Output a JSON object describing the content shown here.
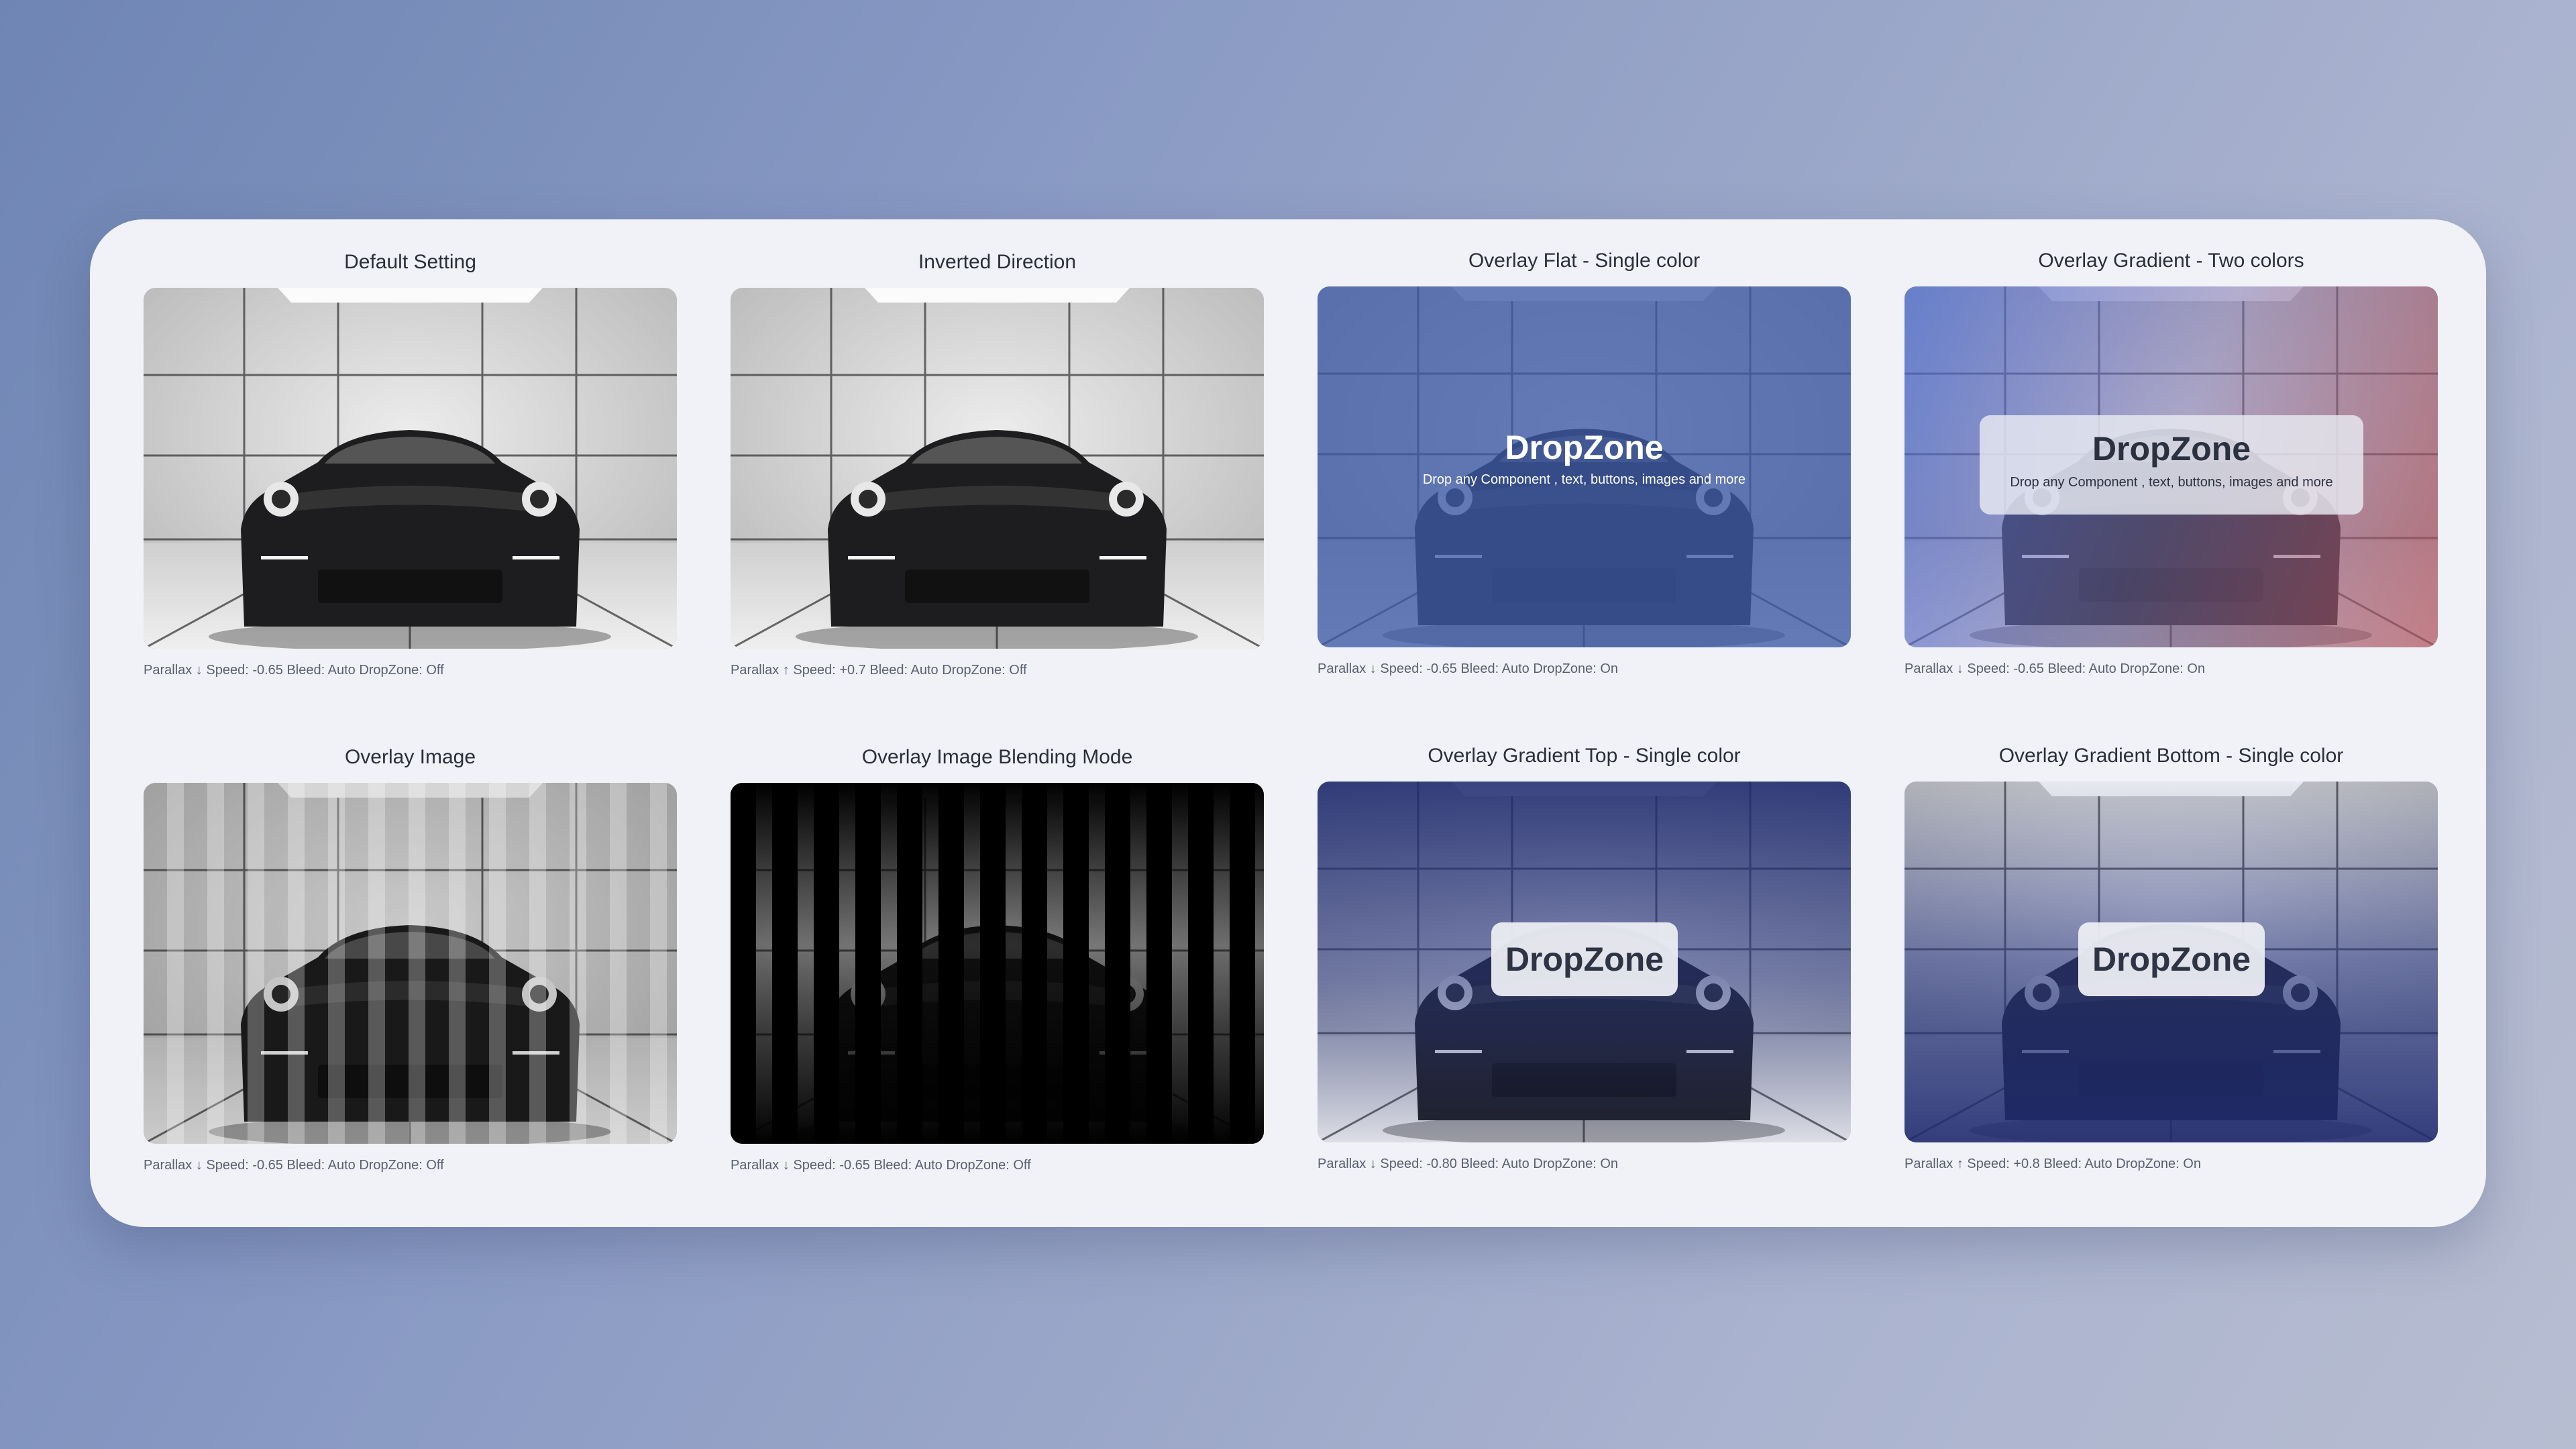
{
  "cards": [
    {
      "title": "Default Setting",
      "caption": "Parallax ↓ Speed: -0.65 Bleed: Auto DropZone: Off"
    },
    {
      "title": "Inverted Direction",
      "caption": "Parallax ↑ Speed: +0.7 Bleed: Auto DropZone: Off"
    },
    {
      "title": "Overlay Flat - Single color",
      "caption": "Parallax ↓ Speed: -0.65 Bleed: Auto DropZone: On",
      "dropzone_title": "DropZone",
      "dropzone_sub": "Drop any Component , text, buttons, images and more"
    },
    {
      "title": "Overlay Gradient - Two colors",
      "caption": "Parallax ↓ Speed: -0.65 Bleed: Auto DropZone: On",
      "dropzone_title": "DropZone",
      "dropzone_sub": "Drop any Component , text, buttons, images and more"
    },
    {
      "title": "Overlay Image",
      "caption": "Parallax ↓ Speed: -0.65 Bleed: Auto DropZone: Off"
    },
    {
      "title": "Overlay Image Blending Mode",
      "caption": "Parallax ↓ Speed: -0.65 Bleed: Auto DropZone: Off"
    },
    {
      "title": "Overlay Gradient Top - Single color",
      "caption": "Parallax ↓ Speed: -0.80 Bleed: Auto DropZone: On",
      "dropzone_title": "DropZone"
    },
    {
      "title": "Overlay Gradient Bottom - Single color",
      "caption": "Parallax ↑ Speed: +0.8 Bleed: Auto DropZone: On",
      "dropzone_title": "DropZone"
    }
  ],
  "colors": {
    "overlay_blue": "#3e5aa8",
    "gradient_left": "#4a6ad0",
    "gradient_right": "#b0505a",
    "gradient_navy": "#1e2a6e"
  },
  "image_subject": "car-photo"
}
